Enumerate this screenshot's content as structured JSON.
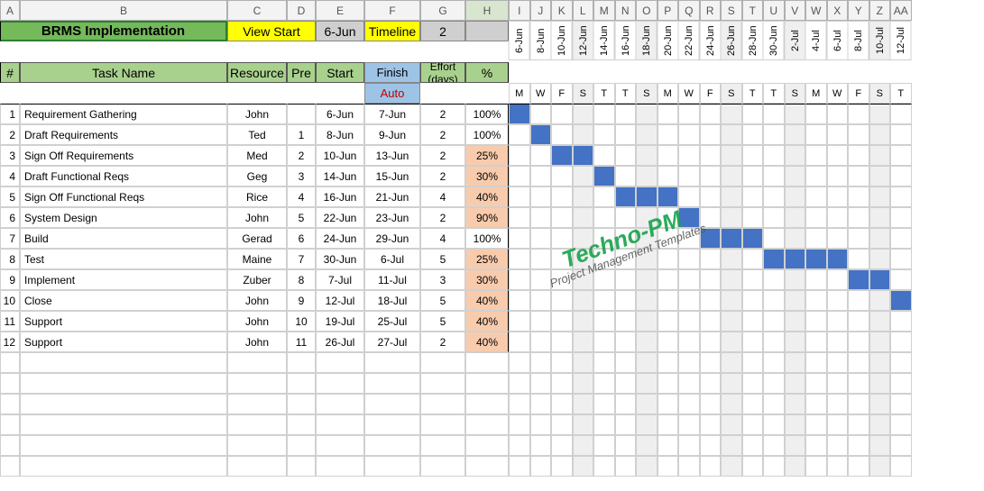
{
  "col_letters": [
    "A",
    "B",
    "C",
    "D",
    "E",
    "F",
    "G",
    "H",
    "I",
    "J",
    "K",
    "L",
    "M",
    "N",
    "O",
    "P",
    "Q",
    "R",
    "S",
    "T",
    "U",
    "V",
    "W",
    "X",
    "Y",
    "Z",
    "AA"
  ],
  "selected_col": "H",
  "title": "BRMS Implementation",
  "view_start_label": "View Start",
  "view_start_date": "6-Jun",
  "timeline_label": "Timeline",
  "timeline_value": "2",
  "hdr": {
    "num": "#",
    "task": "Task Name",
    "resource": "Resource",
    "pre": "Pre",
    "start": "Start",
    "finish": "Finish",
    "auto": "Auto",
    "effort": "Effort (days)",
    "pct": "%"
  },
  "dates": [
    "6-Jun",
    "8-Jun",
    "10-Jun",
    "12-Jun",
    "14-Jun",
    "16-Jun",
    "18-Jun",
    "20-Jun",
    "22-Jun",
    "24-Jun",
    "26-Jun",
    "28-Jun",
    "30-Jun",
    "2-Jul",
    "4-Jul",
    "6-Jul",
    "8-Jul",
    "10-Jul",
    "12-Jul"
  ],
  "dows": [
    "M",
    "W",
    "F",
    "S",
    "T",
    "T",
    "S",
    "M",
    "W",
    "F",
    "S",
    "T",
    "T",
    "S",
    "M",
    "W",
    "F",
    "S",
    "T"
  ],
  "weekend_idx": [
    3,
    6,
    10,
    13,
    17
  ],
  "rows": [
    {
      "n": "1",
      "task": "Requirement Gathering",
      "res": "John",
      "pre": "",
      "start": "6-Jun",
      "finish": "7-Jun",
      "eff": "2",
      "pct": "100%",
      "peach": false,
      "bars": [
        0
      ]
    },
    {
      "n": "2",
      "task": "Draft  Requirements",
      "res": "Ted",
      "pre": "1",
      "start": "8-Jun",
      "finish": "9-Jun",
      "eff": "2",
      "pct": "100%",
      "peach": false,
      "bars": [
        1
      ]
    },
    {
      "n": "3",
      "task": "Sign Off  Requirements",
      "res": "Med",
      "pre": "2",
      "start": "10-Jun",
      "finish": "13-Jun",
      "eff": "2",
      "pct": "25%",
      "peach": true,
      "bars": [
        2,
        3
      ]
    },
    {
      "n": "4",
      "task": "Draft Functional Reqs",
      "res": "Geg",
      "pre": "3",
      "start": "14-Jun",
      "finish": "15-Jun",
      "eff": "2",
      "pct": "30%",
      "peach": true,
      "bars": [
        4
      ]
    },
    {
      "n": "5",
      "task": "Sign Off Functional Reqs",
      "res": "Rice",
      "pre": "4",
      "start": "16-Jun",
      "finish": "21-Jun",
      "eff": "4",
      "pct": "40%",
      "peach": true,
      "bars": [
        5,
        6,
        7
      ]
    },
    {
      "n": "6",
      "task": "System Design",
      "res": "John",
      "pre": "5",
      "start": "22-Jun",
      "finish": "23-Jun",
      "eff": "2",
      "pct": "90%",
      "peach": true,
      "bars": [
        8
      ]
    },
    {
      "n": "7",
      "task": "Build",
      "res": "Gerad",
      "pre": "6",
      "start": "24-Jun",
      "finish": "29-Jun",
      "eff": "4",
      "pct": "100%",
      "peach": false,
      "bars": [
        9,
        10,
        11
      ]
    },
    {
      "n": "8",
      "task": "Test",
      "res": "Maine",
      "pre": "7",
      "start": "30-Jun",
      "finish": "6-Jul",
      "eff": "5",
      "pct": "25%",
      "peach": true,
      "bars": [
        12,
        13,
        14,
        15
      ]
    },
    {
      "n": "9",
      "task": "Implement",
      "res": "Zuber",
      "pre": "8",
      "start": "7-Jul",
      "finish": "11-Jul",
      "eff": "3",
      "pct": "30%",
      "peach": true,
      "bars": [
        16,
        17
      ]
    },
    {
      "n": "10",
      "task": "Close",
      "res": "John",
      "pre": "9",
      "start": "12-Jul",
      "finish": "18-Jul",
      "eff": "5",
      "pct": "40%",
      "peach": true,
      "bars": [
        18
      ]
    },
    {
      "n": "11",
      "task": "Support",
      "res": "John",
      "pre": "10",
      "start": "19-Jul",
      "finish": "25-Jul",
      "eff": "5",
      "pct": "40%",
      "peach": true,
      "bars": []
    },
    {
      "n": "12",
      "task": "Support",
      "res": "John",
      "pre": "11",
      "start": "26-Jul",
      "finish": "27-Jul",
      "eff": "2",
      "pct": "40%",
      "peach": true,
      "bars": []
    }
  ],
  "watermark": {
    "line1": "Techno-PM",
    "line2": "Project Management Templates"
  },
  "empty_rows": 6
}
